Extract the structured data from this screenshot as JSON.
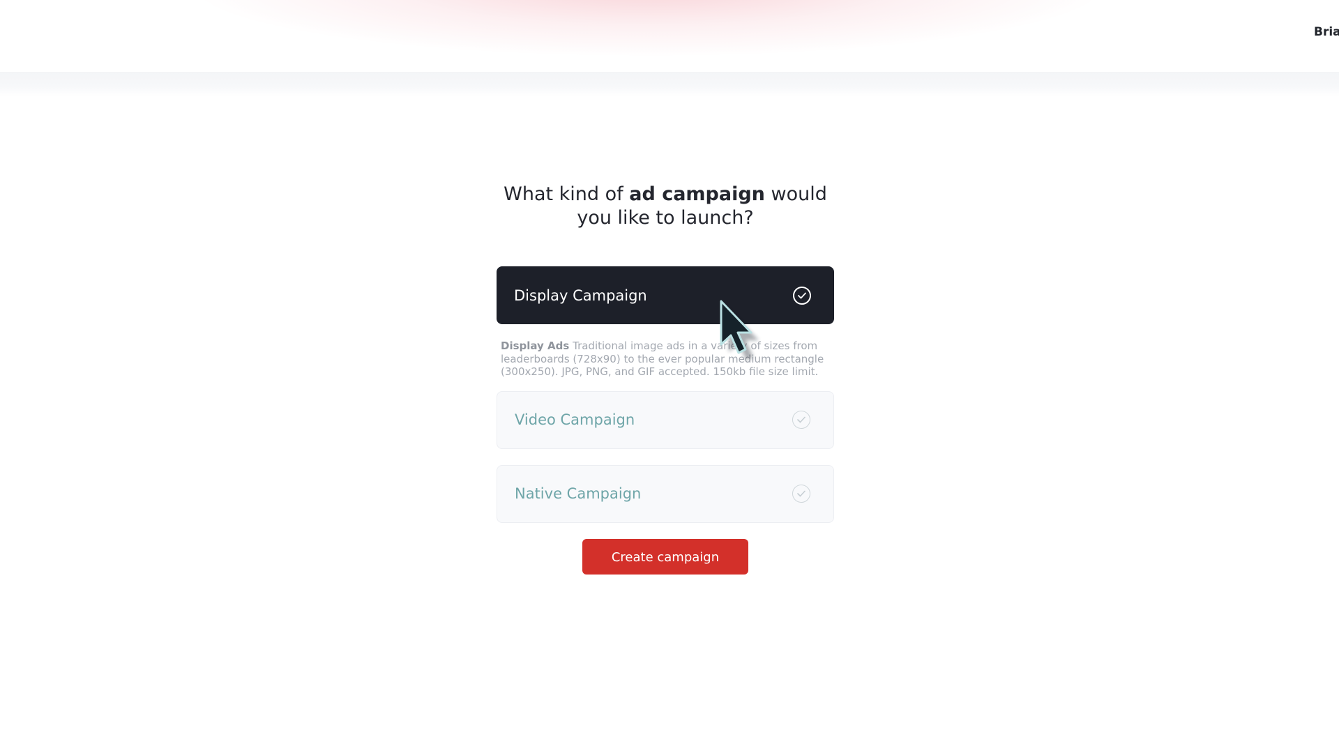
{
  "header": {
    "user_name": "Brian"
  },
  "question": {
    "prefix": "What kind of ",
    "emphasis": "ad campaign",
    "suffix": " would you like to launch?"
  },
  "options": [
    {
      "label": "Display Campaign",
      "selected": true,
      "icon": "check-circle-icon"
    },
    {
      "label": "Video Campaign",
      "selected": false,
      "icon": "check-circle-icon"
    },
    {
      "label": "Native Campaign",
      "selected": false,
      "icon": "check-circle-icon"
    }
  ],
  "description": {
    "title": "Display Ads",
    "body": " Traditional image ads in a variety of sizes from leaderboards (728x90) to the ever popular medium rectangle (300x250). JPG, PNG, and GIF accepted. 150kb file size limit."
  },
  "actions": {
    "create_label": "Create campaign"
  },
  "colors": {
    "selected_bg": "#1d2029",
    "unselected_text": "#6ea5a8",
    "primary_button": "#d3302a"
  }
}
